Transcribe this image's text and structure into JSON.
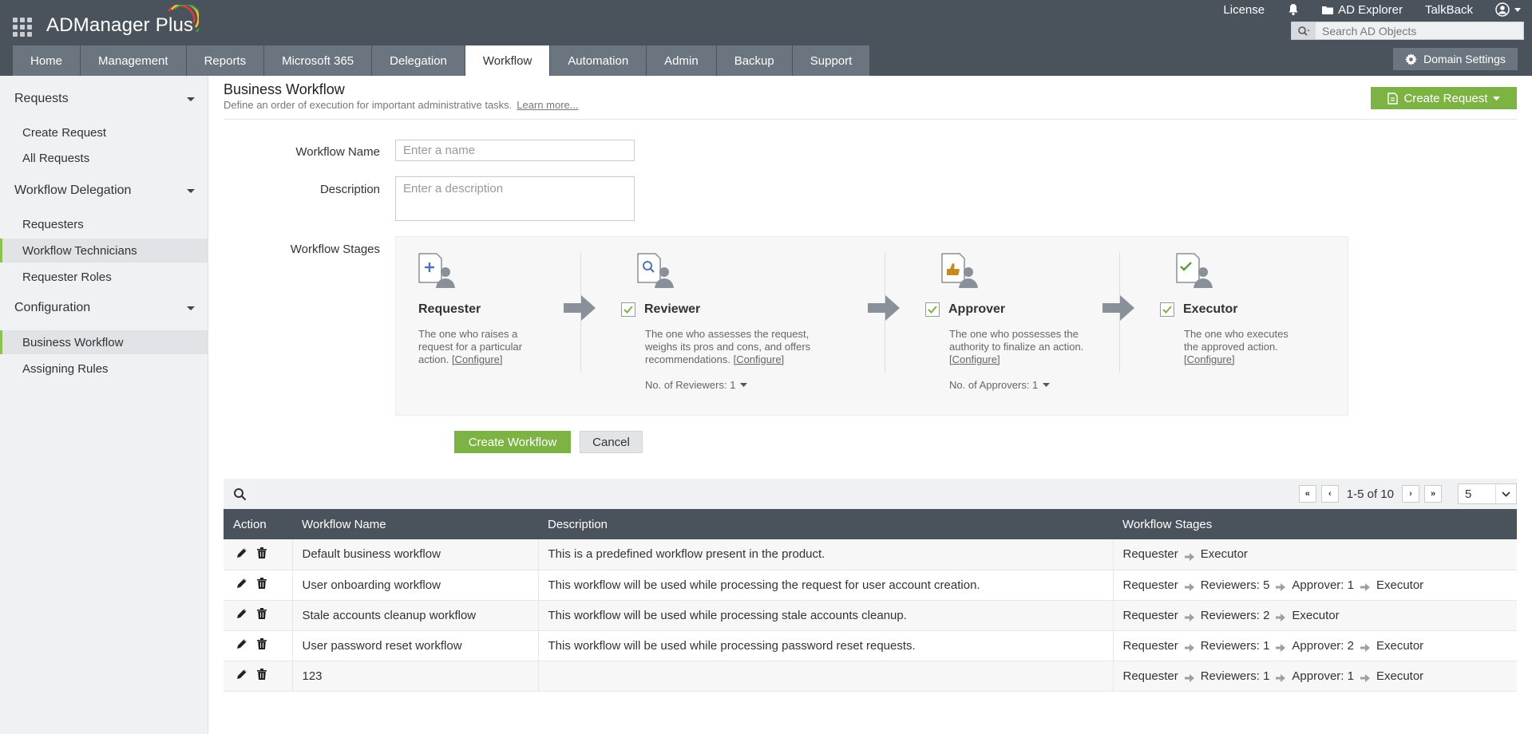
{
  "app": {
    "title": "ADManager Plus"
  },
  "top_links": {
    "license": "License",
    "ad_explorer": "AD Explorer",
    "talkback": "TalkBack"
  },
  "search": {
    "placeholder": "Search AD Objects"
  },
  "nav": {
    "tabs": [
      "Home",
      "Management",
      "Reports",
      "Microsoft 365",
      "Delegation",
      "Workflow",
      "Automation",
      "Admin",
      "Backup",
      "Support"
    ],
    "active": "Workflow",
    "domain_settings": "Domain Settings"
  },
  "sidebar": {
    "sections": [
      {
        "title": "Requests",
        "items": [
          "Create Request",
          "All Requests"
        ]
      },
      {
        "title": "Workflow Delegation",
        "items": [
          "Requesters",
          "Workflow Technicians",
          "Requester Roles"
        ]
      },
      {
        "title": "Configuration",
        "items": [
          "Business Workflow",
          "Assigning Rules"
        ]
      }
    ],
    "highlighted": [
      "Workflow Technicians",
      "Business Workflow"
    ]
  },
  "page": {
    "title": "Business Workflow",
    "subtitle": "Define an order of execution for important administrative tasks.",
    "learn_more": "Learn more...",
    "create_request": "Create Request"
  },
  "form": {
    "name_label": "Workflow Name",
    "name_placeholder": "Enter a name",
    "desc_label": "Description",
    "desc_placeholder": "Enter a description",
    "stages_label": "Workflow Stages",
    "create_button": "Create Workflow",
    "cancel_button": "Cancel"
  },
  "stages": [
    {
      "name": "Requester",
      "desc": "The one who raises a request for a particular action.",
      "configure": "[Configure]",
      "checked": null,
      "count": null
    },
    {
      "name": "Reviewer",
      "desc": "The one who assesses the request, weighs its pros and cons, and offers recommendations.",
      "configure": "[Configure]",
      "checked": true,
      "count": "No. of Reviewers: 1"
    },
    {
      "name": "Approver",
      "desc": "The one who possesses the authority to finalize an action.",
      "configure": "[Configure]",
      "checked": true,
      "count": "No. of Approvers: 1"
    },
    {
      "name": "Executor",
      "desc": "The one who executes the approved action.",
      "configure": "[Configure]",
      "checked": true,
      "count": null
    }
  ],
  "pager": {
    "range": "1-5 of 10",
    "page_size": "5"
  },
  "table": {
    "headers": [
      "Action",
      "Workflow Name",
      "Description",
      "Workflow Stages"
    ],
    "rows": [
      {
        "name": "Default business workflow",
        "desc": "This is a predefined workflow present in the product.",
        "stages": [
          "Requester",
          "Executor"
        ]
      },
      {
        "name": "User onboarding workflow",
        "desc": "This workflow will be used while processing the request for user account creation.",
        "stages": [
          "Requester",
          "Reviewers: 5",
          "Approver: 1",
          "Executor"
        ]
      },
      {
        "name": "Stale accounts cleanup workflow",
        "desc": "This workflow will be used while processing stale accounts cleanup.",
        "stages": [
          "Requester",
          "Reviewers: 2",
          "Executor"
        ]
      },
      {
        "name": "User password reset workflow",
        "desc": "This workflow will be used while processing password reset requests.",
        "stages": [
          "Requester",
          "Reviewers: 1",
          "Approver: 2",
          "Executor"
        ]
      },
      {
        "name": "123",
        "desc": "",
        "stages": [
          "Requester",
          "Reviewers: 1",
          "Approver: 1",
          "Executor"
        ]
      }
    ]
  },
  "colors": {
    "topbar": "#4a535c",
    "tab": "#6b7580",
    "accent_green": "#7cb342",
    "sidebar": "#f0f1f2"
  }
}
